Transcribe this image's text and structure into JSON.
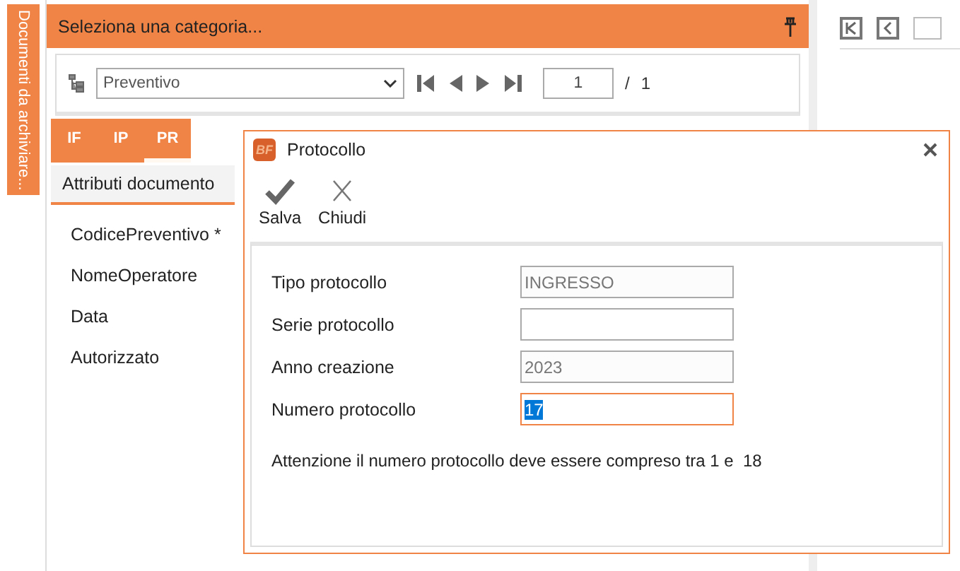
{
  "side_tab": {
    "label": "Documenti da archiviare..."
  },
  "panel": {
    "title": "Seleziona una categoria...",
    "category": "Preventivo",
    "page": "1",
    "page_sep": "/",
    "page_total": "1"
  },
  "doc_tabs": [
    {
      "label": "IF",
      "selected": false
    },
    {
      "label": "IP",
      "selected": false
    },
    {
      "label": "PR",
      "selected": true
    }
  ],
  "section_tab": {
    "label": "Attributi documento",
    "selected": true
  },
  "attributes": [
    "CodicePreventivo *",
    "NomeOperatore",
    "Data",
    "Autorizzato"
  ],
  "dialog": {
    "title": "Protocollo",
    "logo": "BF",
    "actions": [
      {
        "kind": "save",
        "label": "Salva"
      },
      {
        "kind": "close",
        "label": "Chiudi"
      }
    ],
    "fields": [
      {
        "label": "Tipo protocollo",
        "value": "INGRESSO",
        "readonly": true,
        "focused": false
      },
      {
        "label": "Serie protocollo",
        "focused": false
      },
      {
        "label": "Anno creazione",
        "value": "2023",
        "readonly": true,
        "focused": false
      },
      {
        "label": "Numero protocollo",
        "value": "17",
        "readonly": false,
        "focused": true
      }
    ],
    "message": "Attenzione il numero protocollo deve essere compreso tra 1 e  18"
  }
}
